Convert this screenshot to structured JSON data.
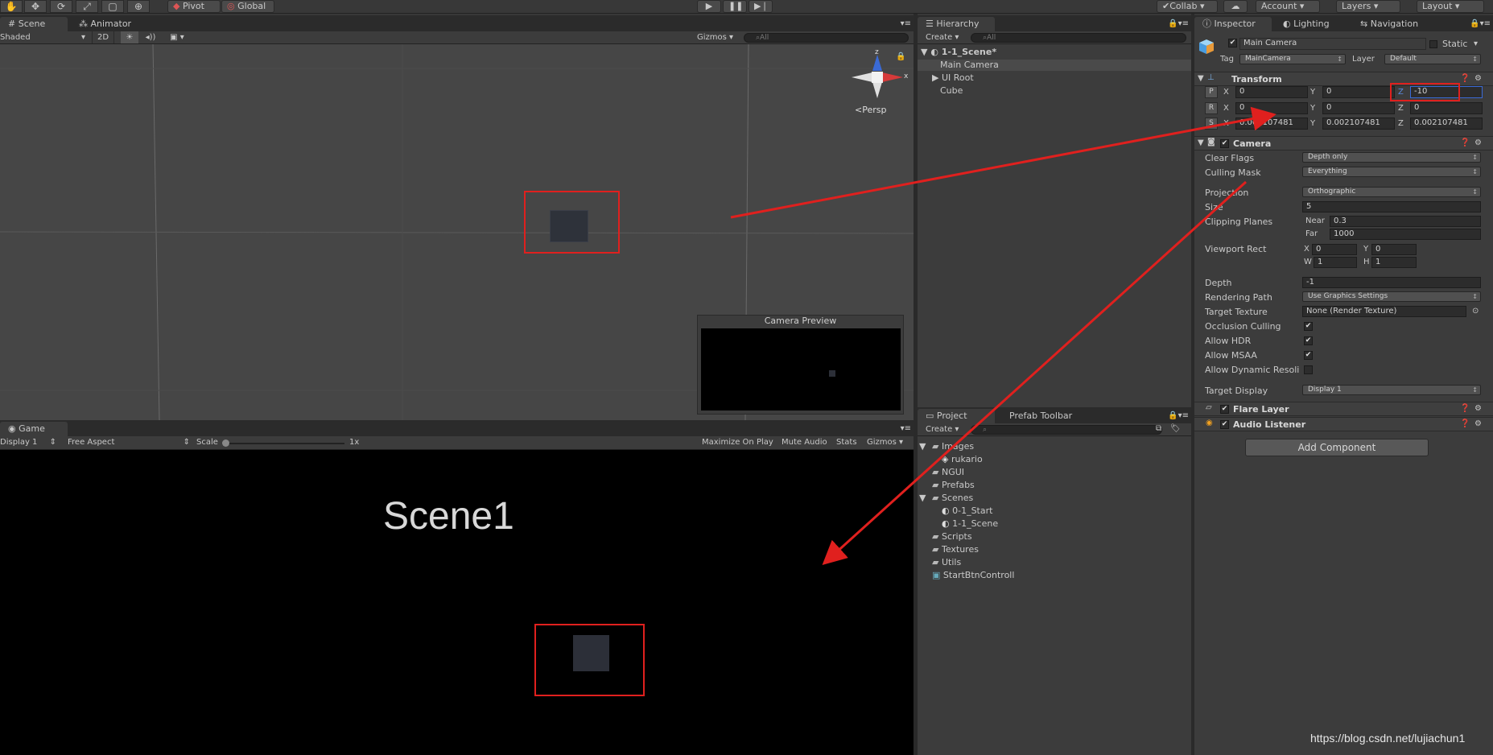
{
  "toolbar": {
    "tool_icons": [
      "hand-icon",
      "move-icon",
      "rotate-icon",
      "scale-icon",
      "rect-icon",
      "transform-icon"
    ],
    "pivot": "Pivot",
    "global": "Global",
    "collab": "Collab",
    "account": "Account",
    "layers": "Layers",
    "layout": "Layout"
  },
  "scene": {
    "tabs": [
      "Scene",
      "Animator"
    ],
    "shading": "Shaded",
    "mode2d": "2D",
    "gizmos": "Gizmos",
    "search_placeholder": "All",
    "persp": "Persp",
    "axis_x": "x",
    "axis_z": "z",
    "camera_preview": "Camera Preview"
  },
  "game": {
    "tab": "Game",
    "display": "Display 1",
    "aspect": "Free Aspect",
    "scale_label": "Scale",
    "scale_value": "1x",
    "maximize": "Maximize On Play",
    "mute": "Mute Audio",
    "stats": "Stats",
    "gizmos": "Gizmos",
    "scene_text": "Scene1"
  },
  "hierarchy": {
    "tab": "Hierarchy",
    "create": "Create",
    "search_placeholder": "All",
    "scene": "1-1_Scene*",
    "items": [
      "Main Camera",
      "UI Root",
      "Cube"
    ]
  },
  "project": {
    "tabs": [
      "Project",
      "Prefab Toolbar"
    ],
    "create": "Create",
    "items": [
      {
        "label": "Images",
        "indent": 0,
        "type": "folder"
      },
      {
        "label": "rukario",
        "indent": 1,
        "type": "asset"
      },
      {
        "label": "NGUI",
        "indent": 0,
        "type": "folder"
      },
      {
        "label": "Prefabs",
        "indent": 0,
        "type": "folder"
      },
      {
        "label": "Scenes",
        "indent": 0,
        "type": "folder"
      },
      {
        "label": "0-1_Start",
        "indent": 1,
        "type": "scene"
      },
      {
        "label": "1-1_Scene",
        "indent": 1,
        "type": "scene"
      },
      {
        "label": "Scripts",
        "indent": 0,
        "type": "folder"
      },
      {
        "label": "Textures",
        "indent": 0,
        "type": "folder"
      },
      {
        "label": "Utils",
        "indent": 0,
        "type": "folder"
      },
      {
        "label": "StartBtnControll",
        "indent": 0,
        "type": "script"
      }
    ]
  },
  "inspector": {
    "tabs": [
      "Inspector",
      "Lighting",
      "Navigation"
    ],
    "object_name": "Main Camera",
    "static": "Static",
    "tag_label": "Tag",
    "tag": "MainCamera",
    "layer_label": "Layer",
    "layer": "Default",
    "transform": {
      "title": "Transform",
      "position": {
        "x": "0",
        "y": "0",
        "z": "-10"
      },
      "rotation": {
        "x": "0",
        "y": "0",
        "z": "0"
      },
      "scale": {
        "x": "0.002107481",
        "y": "0.002107481",
        "z": "0.002107481"
      }
    },
    "camera": {
      "title": "Camera",
      "clear_flags_label": "Clear Flags",
      "clear_flags": "Depth only",
      "culling_mask_label": "Culling Mask",
      "culling_mask": "Everything",
      "projection_label": "Projection",
      "projection": "Orthographic",
      "size_label": "Size",
      "size": "5",
      "clipping_label": "Clipping Planes",
      "near_label": "Near",
      "near": "0.3",
      "far_label": "Far",
      "far": "1000",
      "viewport_label": "Viewport Rect",
      "vx": "0",
      "vy": "0",
      "vw": "1",
      "vh": "1",
      "depth_label": "Depth",
      "depth": "-1",
      "rendering_path_label": "Rendering Path",
      "rendering_path": "Use Graphics Settings",
      "target_texture_label": "Target Texture",
      "target_texture": "None (Render Texture)",
      "occlusion_label": "Occlusion Culling",
      "hdr_label": "Allow HDR",
      "msaa_label": "Allow MSAA",
      "dynres_label": "Allow Dynamic Resoli",
      "target_display_label": "Target Display",
      "target_display": "Display 1"
    },
    "flare_layer": "Flare Layer",
    "audio_listener": "Audio Listener",
    "add_component": "Add Component"
  },
  "watermark": "https://blog.csdn.net/lujiachun1"
}
